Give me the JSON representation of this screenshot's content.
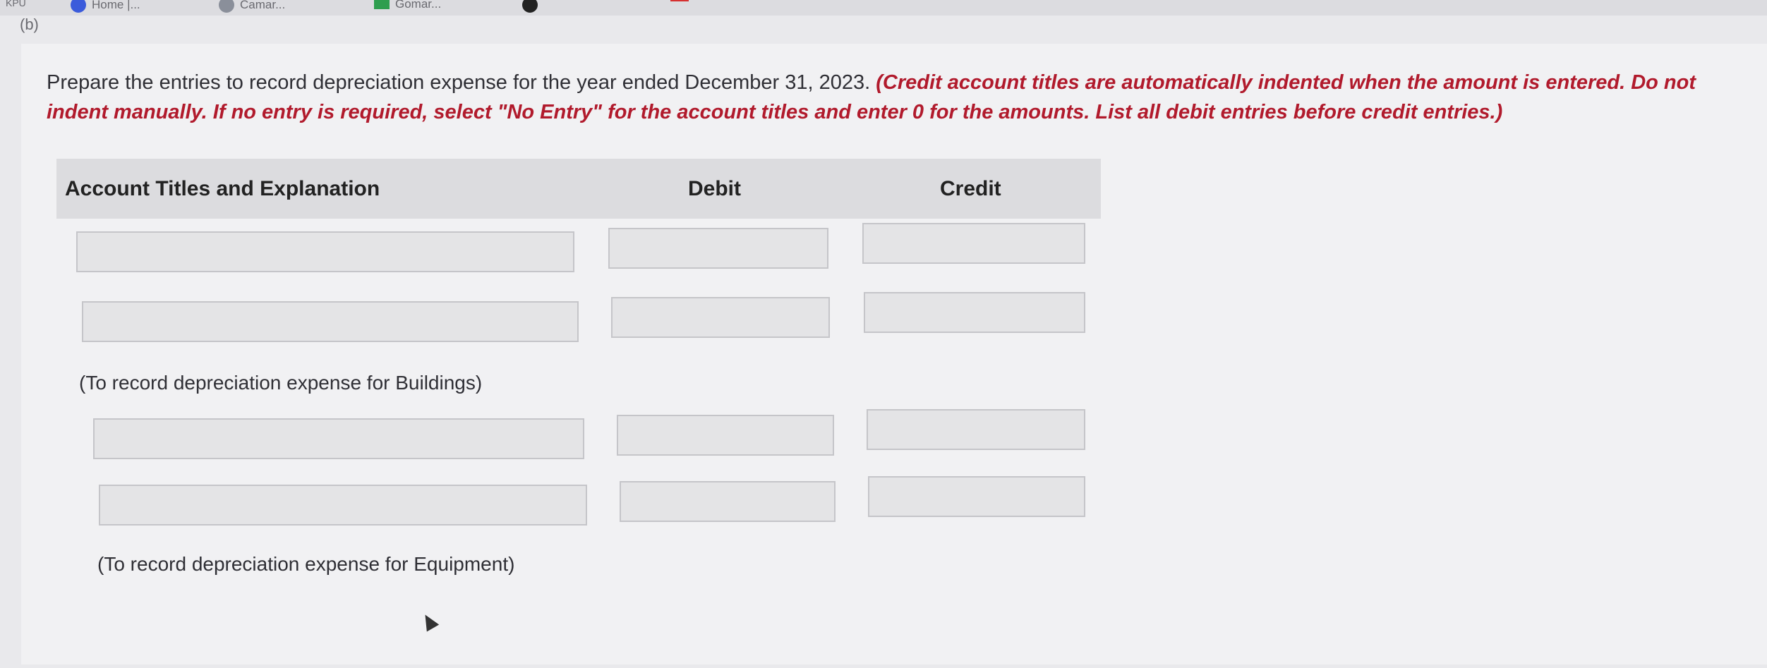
{
  "browser": {
    "bookmarks": [
      "KPU",
      "Home |...",
      "Camar...",
      "Gomar..."
    ]
  },
  "part_label": "(b)",
  "prompt": {
    "text": "Prepare the entries to record depreciation expense for the year ended December 31, 2023.",
    "note": "(Credit account titles are automatically indented when the amount is entered. Do not indent manually. If no entry is required, select \"No Entry\" for the account titles and enter 0 for the amounts. List all debit entries before credit entries.)"
  },
  "table": {
    "headers": {
      "account": "Account Titles and Explanation",
      "debit": "Debit",
      "credit": "Credit"
    },
    "entries": [
      {
        "rows": [
          {
            "account": "",
            "debit": "",
            "credit": ""
          },
          {
            "account": "",
            "debit": "",
            "credit": ""
          }
        ],
        "memo": "(To record depreciation expense for Buildings)"
      },
      {
        "rows": [
          {
            "account": "",
            "debit": "",
            "credit": ""
          },
          {
            "account": "",
            "debit": "",
            "credit": ""
          }
        ],
        "memo": "(To record depreciation expense for Equipment)"
      }
    ]
  },
  "colors": {
    "note_red": "#b11a2c",
    "header_bg": "#dcdcdf",
    "field_bg": "#e4e4e6"
  }
}
